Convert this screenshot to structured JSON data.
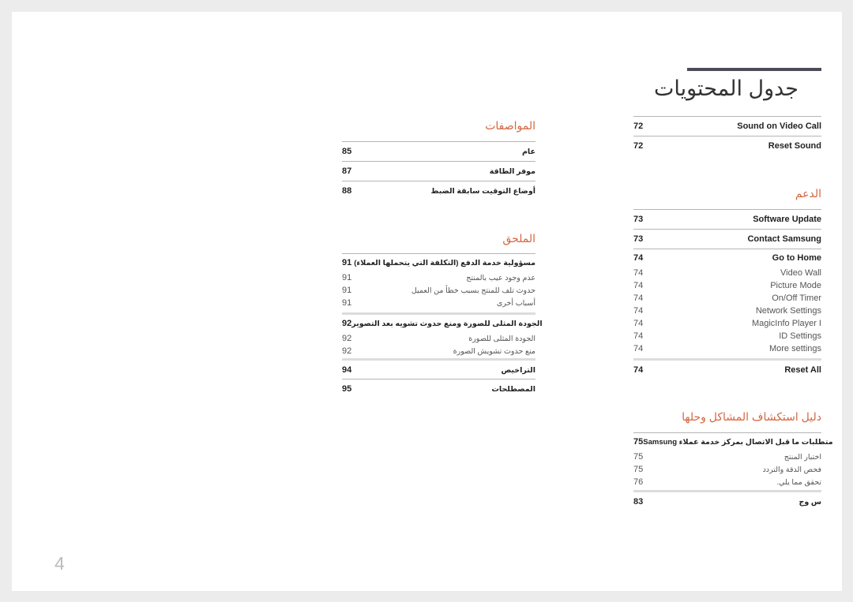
{
  "page_title": "جدول المحتويات",
  "page_number": "4",
  "right_column": {
    "top_items": [
      {
        "label": "Sound on Video Call",
        "page": "72"
      },
      {
        "label": "Reset Sound",
        "page": "72"
      }
    ],
    "support": {
      "heading": "الدعم",
      "items": [
        {
          "label": "Software Update",
          "page": "73"
        },
        {
          "label": "Contact Samsung",
          "page": "73"
        }
      ]
    },
    "go_to_home": {
      "label": "Go to Home",
      "page": "74",
      "subitems": [
        {
          "label": "Video Wall",
          "page": "74"
        },
        {
          "label": "Picture Mode",
          "page": "74"
        },
        {
          "label": "On/Off Timer",
          "page": "74"
        },
        {
          "label": "Network Settings",
          "page": "74"
        },
        {
          "label": "MagicInfo Player I",
          "page": "74"
        },
        {
          "label": "ID Settings",
          "page": "74"
        },
        {
          "label": "More settings",
          "page": "74"
        }
      ]
    },
    "reset_all": {
      "label": "Reset All",
      "page": "74"
    },
    "troubleshooting": {
      "heading": "دليل استكشاف المشاكل وحلها",
      "main": {
        "label": "متطلبات ما قبل الاتصال بمركز خدمة عملاء Samsung",
        "page": "75",
        "subitems": [
          {
            "label": "اختبار المنتج",
            "page": "75"
          },
          {
            "label": "فحص الدقة والتردد",
            "page": "75"
          },
          {
            "label": "تحقق مما يلي.",
            "page": "76"
          }
        ]
      },
      "faq": {
        "label": "س وج",
        "page": "83"
      }
    }
  },
  "middle_column": {
    "specifications": {
      "heading": "المواصفات",
      "items": [
        {
          "label": "عام",
          "page": "85"
        },
        {
          "label": "موفر الطاقة",
          "page": "87"
        },
        {
          "label": "أوضاع التوقيت سابقة الضبط",
          "page": "88"
        }
      ]
    },
    "appendix": {
      "heading": "الملحق",
      "charge": {
        "label": "مسؤولية خدمة الدفع (التكلفة التي يتحملها العملاء)",
        "page": "91",
        "subitems": [
          {
            "label": "عدم وجود عيب بالمنتج",
            "page": "91"
          },
          {
            "label": "حدوث تلف للمنتج بسبب خطأ من العميل",
            "page": "91"
          },
          {
            "label": "أسباب أخرى",
            "page": "91"
          }
        ]
      },
      "picture_quality": {
        "label": "الجودة المثلى للصورة ومنع حدوث تشويه بعد التصوير",
        "page": "92",
        "subitems": [
          {
            "label": "الجودة المثلى للصورة",
            "page": "92"
          },
          {
            "label": "منع حدوث تشويش الصورة",
            "page": "92"
          }
        ]
      },
      "license": {
        "label": "التراخيص",
        "page": "94"
      },
      "terminology": {
        "label": "المصطلحات",
        "page": "95"
      }
    }
  }
}
